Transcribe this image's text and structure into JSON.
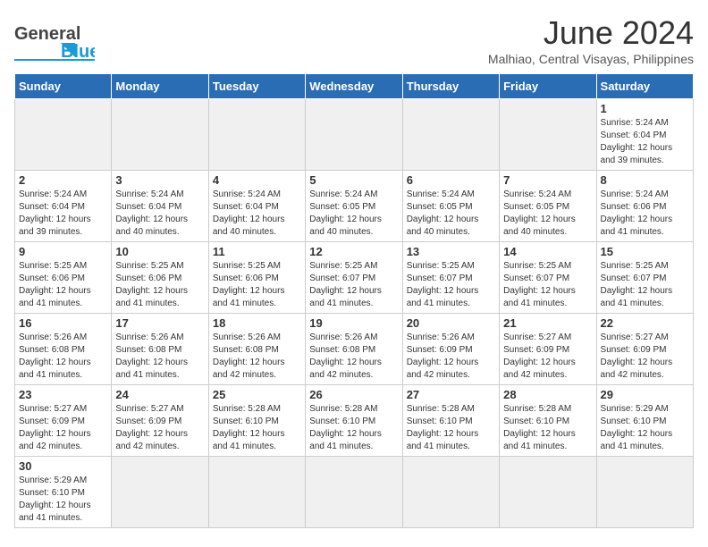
{
  "header": {
    "month_title": "June 2024",
    "location": "Malhiao, Central Visayas, Philippines",
    "logo_general": "General",
    "logo_blue": "Blue"
  },
  "days_of_week": [
    "Sunday",
    "Monday",
    "Tuesday",
    "Wednesday",
    "Thursday",
    "Friday",
    "Saturday"
  ],
  "weeks": [
    [
      {
        "day": "",
        "info": "",
        "empty": true
      },
      {
        "day": "",
        "info": "",
        "empty": true
      },
      {
        "day": "",
        "info": "",
        "empty": true
      },
      {
        "day": "",
        "info": "",
        "empty": true
      },
      {
        "day": "",
        "info": "",
        "empty": true
      },
      {
        "day": "",
        "info": "",
        "empty": true
      },
      {
        "day": "1",
        "info": "Sunrise: 5:24 AM\nSunset: 6:04 PM\nDaylight: 12 hours and 39 minutes."
      }
    ],
    [
      {
        "day": "2",
        "info": "Sunrise: 5:24 AM\nSunset: 6:04 PM\nDaylight: 12 hours and 39 minutes."
      },
      {
        "day": "3",
        "info": "Sunrise: 5:24 AM\nSunset: 6:04 PM\nDaylight: 12 hours and 40 minutes."
      },
      {
        "day": "4",
        "info": "Sunrise: 5:24 AM\nSunset: 6:04 PM\nDaylight: 12 hours and 40 minutes."
      },
      {
        "day": "5",
        "info": "Sunrise: 5:24 AM\nSunset: 6:05 PM\nDaylight: 12 hours and 40 minutes."
      },
      {
        "day": "6",
        "info": "Sunrise: 5:24 AM\nSunset: 6:05 PM\nDaylight: 12 hours and 40 minutes."
      },
      {
        "day": "7",
        "info": "Sunrise: 5:24 AM\nSunset: 6:05 PM\nDaylight: 12 hours and 40 minutes."
      },
      {
        "day": "8",
        "info": "Sunrise: 5:24 AM\nSunset: 6:06 PM\nDaylight: 12 hours and 41 minutes."
      }
    ],
    [
      {
        "day": "9",
        "info": "Sunrise: 5:25 AM\nSunset: 6:06 PM\nDaylight: 12 hours and 41 minutes."
      },
      {
        "day": "10",
        "info": "Sunrise: 5:25 AM\nSunset: 6:06 PM\nDaylight: 12 hours and 41 minutes."
      },
      {
        "day": "11",
        "info": "Sunrise: 5:25 AM\nSunset: 6:06 PM\nDaylight: 12 hours and 41 minutes."
      },
      {
        "day": "12",
        "info": "Sunrise: 5:25 AM\nSunset: 6:07 PM\nDaylight: 12 hours and 41 minutes."
      },
      {
        "day": "13",
        "info": "Sunrise: 5:25 AM\nSunset: 6:07 PM\nDaylight: 12 hours and 41 minutes."
      },
      {
        "day": "14",
        "info": "Sunrise: 5:25 AM\nSunset: 6:07 PM\nDaylight: 12 hours and 41 minutes."
      },
      {
        "day": "15",
        "info": "Sunrise: 5:25 AM\nSunset: 6:07 PM\nDaylight: 12 hours and 41 minutes."
      }
    ],
    [
      {
        "day": "16",
        "info": "Sunrise: 5:26 AM\nSunset: 6:08 PM\nDaylight: 12 hours and 41 minutes."
      },
      {
        "day": "17",
        "info": "Sunrise: 5:26 AM\nSunset: 6:08 PM\nDaylight: 12 hours and 41 minutes."
      },
      {
        "day": "18",
        "info": "Sunrise: 5:26 AM\nSunset: 6:08 PM\nDaylight: 12 hours and 42 minutes."
      },
      {
        "day": "19",
        "info": "Sunrise: 5:26 AM\nSunset: 6:08 PM\nDaylight: 12 hours and 42 minutes."
      },
      {
        "day": "20",
        "info": "Sunrise: 5:26 AM\nSunset: 6:09 PM\nDaylight: 12 hours and 42 minutes."
      },
      {
        "day": "21",
        "info": "Sunrise: 5:27 AM\nSunset: 6:09 PM\nDaylight: 12 hours and 42 minutes."
      },
      {
        "day": "22",
        "info": "Sunrise: 5:27 AM\nSunset: 6:09 PM\nDaylight: 12 hours and 42 minutes."
      }
    ],
    [
      {
        "day": "23",
        "info": "Sunrise: 5:27 AM\nSunset: 6:09 PM\nDaylight: 12 hours and 42 minutes."
      },
      {
        "day": "24",
        "info": "Sunrise: 5:27 AM\nSunset: 6:09 PM\nDaylight: 12 hours and 42 minutes."
      },
      {
        "day": "25",
        "info": "Sunrise: 5:28 AM\nSunset: 6:10 PM\nDaylight: 12 hours and 41 minutes."
      },
      {
        "day": "26",
        "info": "Sunrise: 5:28 AM\nSunset: 6:10 PM\nDaylight: 12 hours and 41 minutes."
      },
      {
        "day": "27",
        "info": "Sunrise: 5:28 AM\nSunset: 6:10 PM\nDaylight: 12 hours and 41 minutes."
      },
      {
        "day": "28",
        "info": "Sunrise: 5:28 AM\nSunset: 6:10 PM\nDaylight: 12 hours and 41 minutes."
      },
      {
        "day": "29",
        "info": "Sunrise: 5:29 AM\nSunset: 6:10 PM\nDaylight: 12 hours and 41 minutes."
      }
    ],
    [
      {
        "day": "30",
        "info": "Sunrise: 5:29 AM\nSunset: 6:10 PM\nDaylight: 12 hours and 41 minutes."
      },
      {
        "day": "",
        "info": "",
        "empty": true
      },
      {
        "day": "",
        "info": "",
        "empty": true
      },
      {
        "day": "",
        "info": "",
        "empty": true
      },
      {
        "day": "",
        "info": "",
        "empty": true
      },
      {
        "day": "",
        "info": "",
        "empty": true
      },
      {
        "day": "",
        "info": "",
        "empty": true
      }
    ]
  ]
}
